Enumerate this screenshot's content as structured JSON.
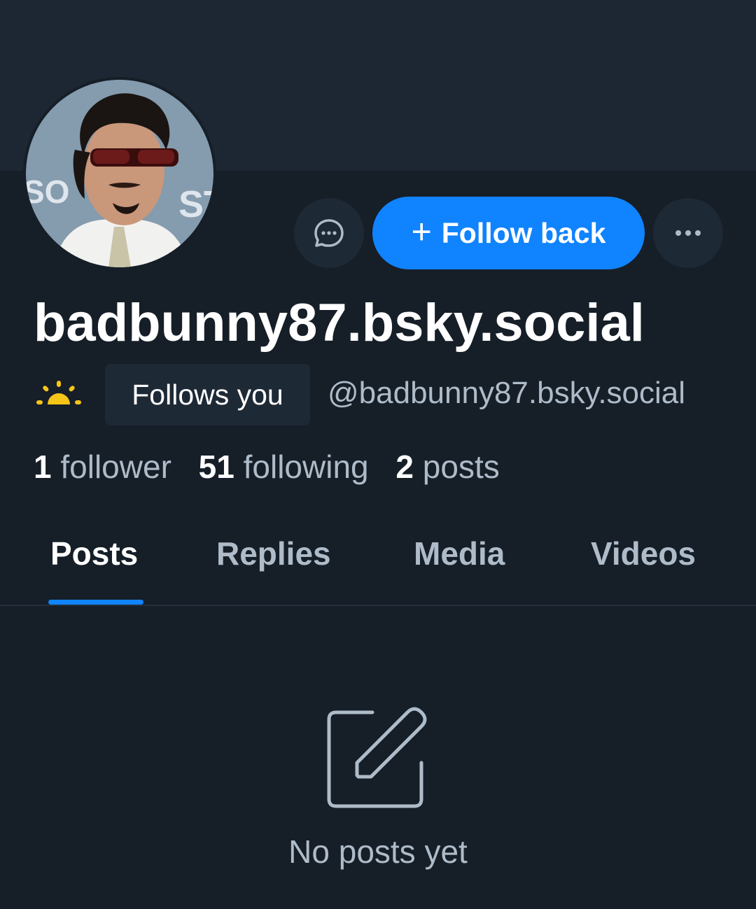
{
  "profile": {
    "display_name": "badbunny87.bsky.social",
    "handle": "@badbunny87.bsky.social",
    "follows_you_badge": "Follows you",
    "avatar_description_icon": "profile-avatar"
  },
  "actions": {
    "message_icon": "chat-bubble-icon",
    "follow_back_label": "Follow back",
    "follow_plus_glyph": "+",
    "more_icon": "ellipsis-icon"
  },
  "stats": {
    "followers_count": "1",
    "followers_label": "follower",
    "following_count": "51",
    "following_label": "following",
    "posts_count": "2",
    "posts_label": "posts"
  },
  "tabs": [
    {
      "label": "Posts",
      "active": true
    },
    {
      "label": "Replies",
      "active": false
    },
    {
      "label": "Media",
      "active": false
    },
    {
      "label": "Videos",
      "active": false
    }
  ],
  "empty_state": {
    "icon": "compose-icon",
    "text": "No posts yet"
  },
  "colors": {
    "background": "#161e27",
    "banner": "#1d2733",
    "accent": "#1083fe",
    "muted_text": "#aebbc9",
    "chip_bg": "#1e2936",
    "sun": "#f5c518"
  }
}
